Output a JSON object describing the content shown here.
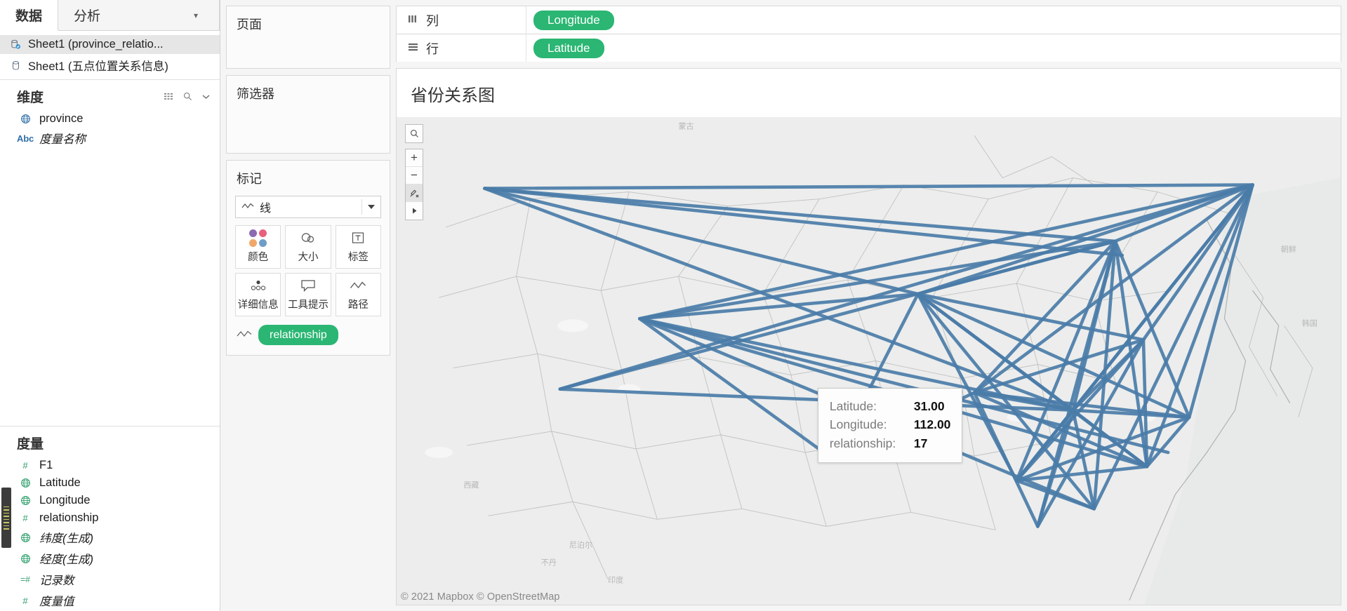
{
  "data_pane": {
    "tabs": [
      {
        "label": "数据",
        "active": true
      },
      {
        "label": "分析",
        "active": false
      }
    ],
    "datasources": [
      {
        "label": "Sheet1 (province_relatio...",
        "icon": "database-active-icon",
        "selected": true
      },
      {
        "label": "Sheet1 (五点位置关系信息)",
        "icon": "database-icon",
        "selected": false
      }
    ],
    "dimensions": {
      "title": "维度",
      "tools": [
        "grid-view-icon",
        "search-icon",
        "chevron-down-icon"
      ],
      "fields": [
        {
          "label": "province",
          "icon": "globe-icon",
          "italic": false
        },
        {
          "label": "度量名称",
          "icon": "abc-icon",
          "italic": true
        }
      ]
    },
    "measures": {
      "title": "度量",
      "fields": [
        {
          "label": "F1",
          "icon": "number-icon",
          "italic": false
        },
        {
          "label": "Latitude",
          "icon": "globe-icon",
          "italic": false
        },
        {
          "label": "Longitude",
          "icon": "globe-icon",
          "italic": false
        },
        {
          "label": "relationship",
          "icon": "number-icon",
          "italic": false
        },
        {
          "label": "纬度(生成)",
          "icon": "globe-icon",
          "italic": true
        },
        {
          "label": "经度(生成)",
          "icon": "globe-icon",
          "italic": true
        },
        {
          "label": "记录数",
          "icon": "count-number-icon",
          "italic": true
        },
        {
          "label": "度量值",
          "icon": "number-icon",
          "italic": true
        }
      ]
    }
  },
  "cards": {
    "pages": {
      "title": "页面"
    },
    "filters": {
      "title": "筛选器"
    },
    "marks": {
      "title": "标记",
      "mark_type": "线",
      "buttons": [
        {
          "label": "颜色",
          "icon": "color-palette-icon"
        },
        {
          "label": "大小",
          "icon": "size-circles-icon"
        },
        {
          "label": "标签",
          "icon": "label-icon"
        },
        {
          "label": "详细信息",
          "icon": "detail-dots-icon"
        },
        {
          "label": "工具提示",
          "icon": "tooltip-bubble-icon"
        },
        {
          "label": "路径",
          "icon": "path-line-icon"
        }
      ],
      "encodings": [
        {
          "icon": "path-line-icon",
          "pill": "relationship"
        }
      ]
    }
  },
  "shelves": [
    {
      "icon": "columns-icon",
      "label": "列",
      "pill": "Longitude"
    },
    {
      "icon": "rows-icon",
      "label": "行",
      "pill": "Latitude"
    }
  ],
  "view": {
    "title": "省份关系图",
    "map_controls": [
      {
        "name": "search-icon",
        "glyph": "⌕"
      },
      {
        "name": "zoom-in-icon",
        "glyph": "+"
      },
      {
        "name": "zoom-out-icon",
        "glyph": "−"
      },
      {
        "name": "clear-pins-icon",
        "glyph": "pin"
      },
      {
        "name": "expand-arrow-icon",
        "glyph": "▶"
      }
    ],
    "attribution": "© 2021 Mapbox © OpenStreetMap",
    "tooltip": {
      "rows": [
        {
          "key": "Latitude:",
          "value": "31.00"
        },
        {
          "key": "Longitude:",
          "value": "112.00"
        },
        {
          "key": "relationship:",
          "value": "17"
        }
      ]
    },
    "line_color": "#4a7ca8"
  },
  "colors": {
    "pill_green": "#2bb673",
    "icon_blue": "#2f6fa8",
    "icon_green": "#2e9e6b",
    "map_line": "#4a7ca8"
  }
}
